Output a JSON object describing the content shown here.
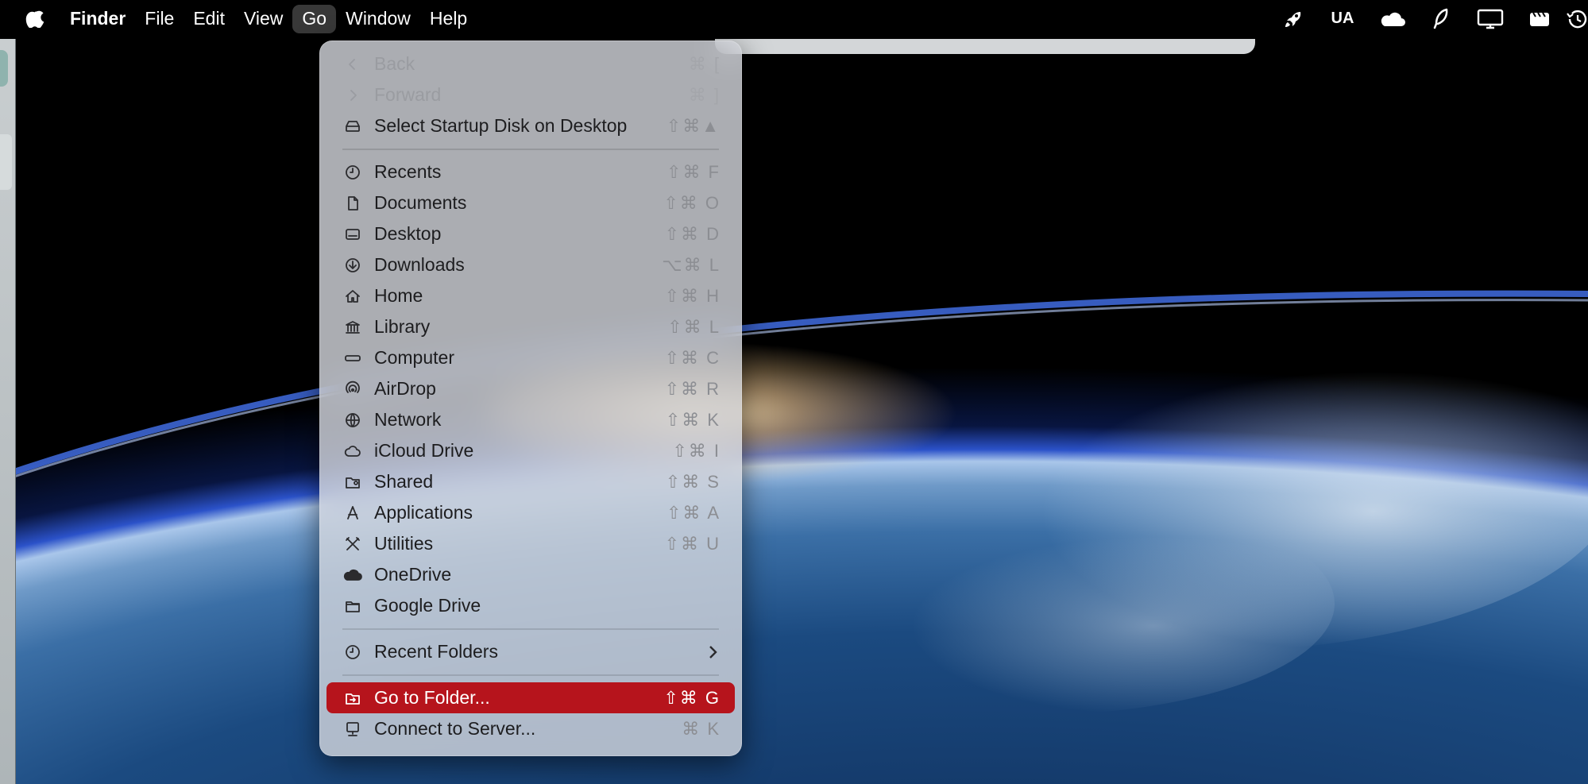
{
  "menubar": {
    "app_name": "Finder",
    "menus": [
      "File",
      "Edit",
      "View",
      "Go",
      "Window",
      "Help"
    ],
    "open_menu": "Go",
    "status_items": {
      "input_source": "UA"
    }
  },
  "go_menu": {
    "items": [
      {
        "label": "Back",
        "shortcut": "⌘ [",
        "icon": "chevron-left-icon",
        "disabled": true
      },
      {
        "label": "Forward",
        "shortcut": "⌘ ]",
        "icon": "chevron-right-icon",
        "disabled": true
      },
      {
        "label": "Select Startup Disk on Desktop",
        "shortcut": "⇧⌘▲",
        "icon": "disk-icon"
      },
      {
        "label": "Recents",
        "shortcut": "⇧⌘ F",
        "icon": "clock-icon"
      },
      {
        "label": "Documents",
        "shortcut": "⇧⌘ O",
        "icon": "document-icon"
      },
      {
        "label": "Desktop",
        "shortcut": "⇧⌘ D",
        "icon": "desktop-icon"
      },
      {
        "label": "Downloads",
        "shortcut": "⌥⌘ L",
        "icon": "download-icon"
      },
      {
        "label": "Home",
        "shortcut": "⇧⌘ H",
        "icon": "home-icon"
      },
      {
        "label": "Library",
        "shortcut": "⇧⌘ L",
        "icon": "library-icon"
      },
      {
        "label": "Computer",
        "shortcut": "⇧⌘ C",
        "icon": "computer-icon"
      },
      {
        "label": "AirDrop",
        "shortcut": "⇧⌘ R",
        "icon": "airdrop-icon"
      },
      {
        "label": "Network",
        "shortcut": "⇧⌘ K",
        "icon": "network-icon"
      },
      {
        "label": "iCloud Drive",
        "shortcut": "⇧⌘ I",
        "icon": "cloud-icon"
      },
      {
        "label": "Shared",
        "shortcut": "⇧⌘ S",
        "icon": "shared-folder-icon"
      },
      {
        "label": "Applications",
        "shortcut": "⇧⌘ A",
        "icon": "applications-icon"
      },
      {
        "label": "Utilities",
        "shortcut": "⇧⌘ U",
        "icon": "utilities-icon"
      },
      {
        "label": "OneDrive",
        "shortcut": "",
        "icon": "onedrive-icon"
      },
      {
        "label": "Google Drive",
        "shortcut": "",
        "icon": "folder-icon"
      },
      {
        "label": "Recent Folders",
        "shortcut": "",
        "icon": "clock-icon",
        "submenu": true
      },
      {
        "label": "Go to Folder...",
        "shortcut": "⇧⌘ G",
        "icon": "go-folder-icon",
        "highlighted": true
      },
      {
        "label": "Connect to Server...",
        "shortcut": "⌘ K",
        "icon": "server-icon"
      }
    ]
  },
  "colors": {
    "highlight": "#b6141c",
    "menu_bg": "#d6d8de",
    "menubar_bg": "#000000"
  }
}
